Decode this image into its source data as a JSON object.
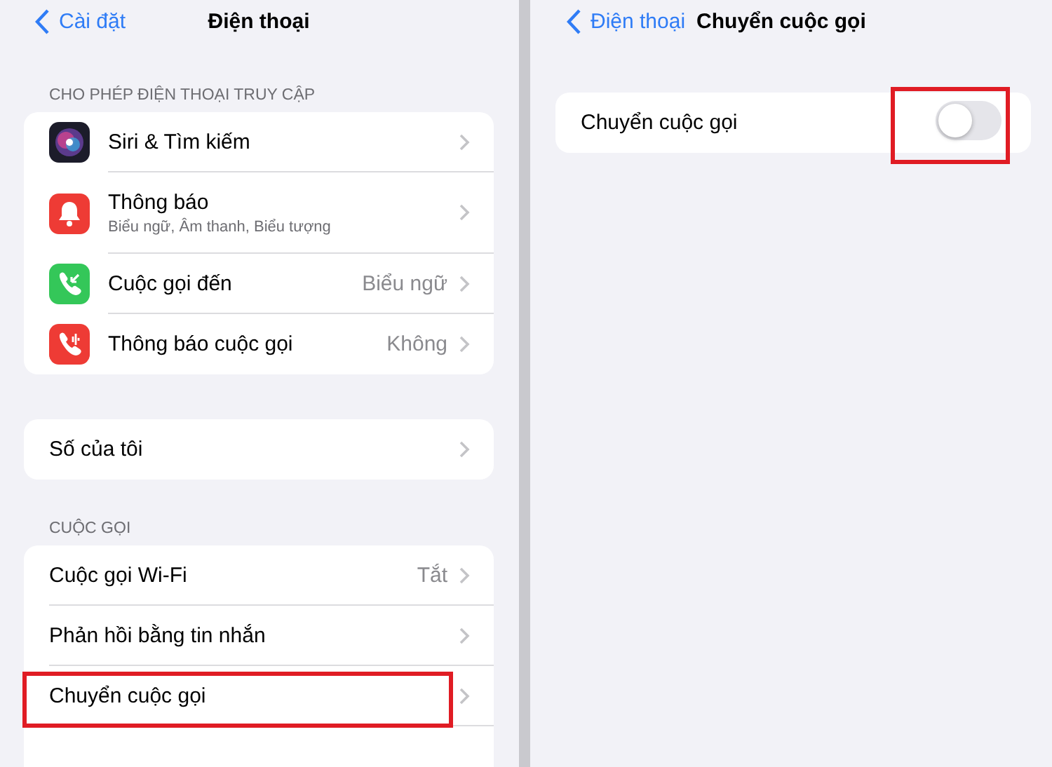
{
  "left_pane": {
    "nav": {
      "back": "Cài đặt",
      "title": "Điện thoại"
    },
    "sections": [
      {
        "header": "CHO PHÉP ĐIỆN THOẠI TRUY CẬP",
        "rows": [
          {
            "kind": "app",
            "label": "Siri & Tìm kiếm",
            "highlighted": false
          },
          {
            "kind": "app",
            "label": "Thông báo",
            "subtitle": "Biểu ngữ, Âm thanh, Biểu tượng",
            "highlighted": false
          },
          {
            "kind": "app",
            "label": "Cuộc gọi đến",
            "value": "Biểu ngữ",
            "highlighted": false
          },
          {
            "kind": "app",
            "label": "Thông báo cuộc gọi",
            "value": "Không",
            "highlighted": false
          }
        ]
      },
      {
        "rows": [
          {
            "kind": "plain",
            "label": "Số của tôi",
            "highlighted": false
          }
        ]
      },
      {
        "header": "CUỘC GỌI",
        "rows": [
          {
            "kind": "plain",
            "label": "Cuộc gọi Wi-Fi",
            "value": "Tắt",
            "highlighted": false
          },
          {
            "kind": "plain",
            "label": "Phản hồi bằng tin nhắn",
            "highlighted": false
          },
          {
            "kind": "plain",
            "label": "Chuyển cuộc gọi",
            "highlighted": true
          }
        ]
      }
    ]
  },
  "right_pane": {
    "nav": {
      "back": "Điện thoại",
      "title": "Chuyển cuộc gọi"
    },
    "rows": [
      {
        "kind": "toggle",
        "label": "Chuyển cuộc gọi",
        "on": false,
        "highlighted": true
      }
    ]
  }
}
